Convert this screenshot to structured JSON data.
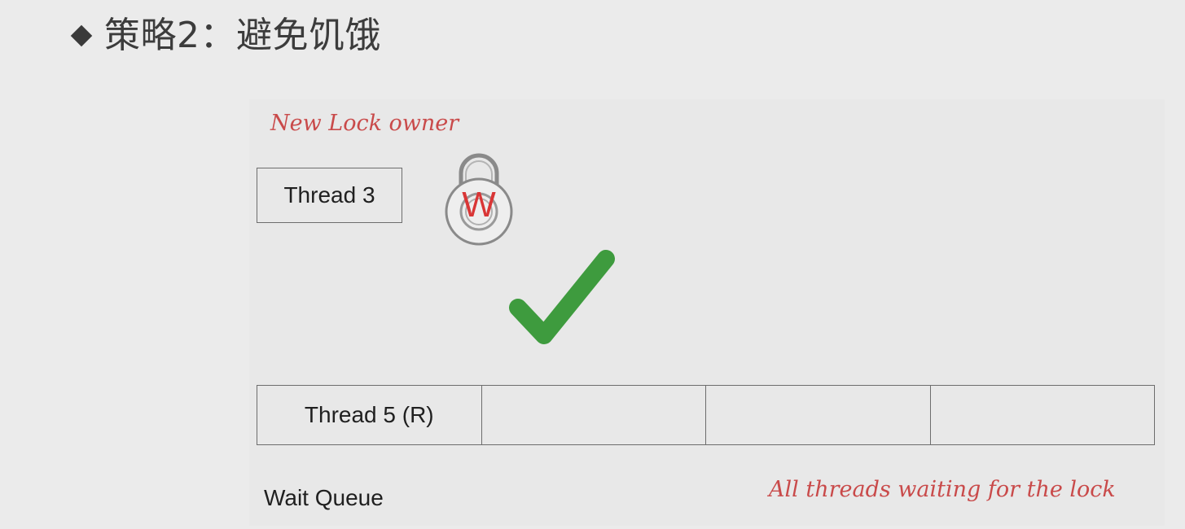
{
  "title": "策略2：避免饥饿",
  "icons": {
    "bullet": "diamond-bullet-icon",
    "lock": "padlock-icon",
    "check": "checkmark-icon"
  },
  "colors": {
    "annotation": "#c94a4a",
    "lock_letter": "#d93636",
    "check": "#3e9b3e",
    "border": "#6d6d6d"
  },
  "diagram": {
    "owner_annotation": "New Lock owner",
    "owner_thread": "Thread 3",
    "lock_mode": "W",
    "queue": [
      {
        "label": "Thread 5 (R)"
      },
      {
        "label": ""
      },
      {
        "label": ""
      },
      {
        "label": ""
      }
    ],
    "queue_label": "Wait Queue",
    "queue_annotation": "All threads waiting for the lock"
  }
}
